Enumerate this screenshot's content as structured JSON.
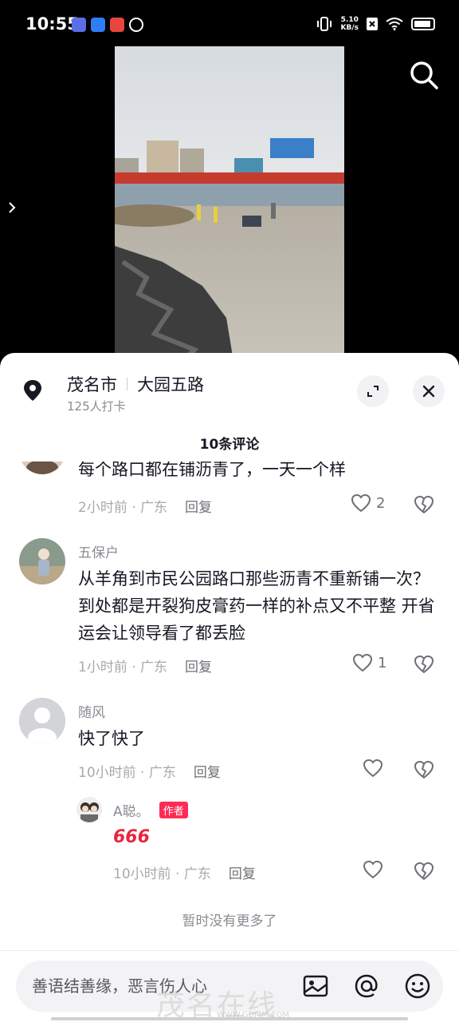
{
  "status_bar": {
    "time": "10:55",
    "net_speed_value": "5.10",
    "net_speed_unit": "KB/s",
    "icons": [
      "vibrate-icon",
      "close-box-icon",
      "wifi-icon",
      "battery-icon"
    ]
  },
  "video": {
    "icons": [
      "search-icon",
      "chevron-right-icon"
    ]
  },
  "location": {
    "city": "茂名市",
    "road": "大园五路",
    "checkins": "125人打卡",
    "icons": [
      "location-pin-icon",
      "expand-icon",
      "close-icon"
    ]
  },
  "comments_header": {
    "count_label": "10条评论"
  },
  "comments": [
    {
      "text": "每个路口都在铺沥青了，一天一个样",
      "time": "2小时前 · 广东",
      "reply_label": "回复",
      "likes": "2"
    },
    {
      "name": "五保户",
      "text": "从羊角到市民公园路口那些沥青不重新铺一次？到处都是开裂狗皮膏药一样的补点又不平整  开省运会让领导看了都丢脸",
      "time": "1小时前 · 广东",
      "reply_label": "回复",
      "likes": "1"
    },
    {
      "name": "随风",
      "text": "快了快了",
      "time": "10小时前 · 广东",
      "reply_label": "回复",
      "likes": ""
    }
  ],
  "reply": {
    "name": "A聪。",
    "tag": "作者",
    "text": "666",
    "time": "10小时前 · 广东",
    "reply_label": "回复"
  },
  "footer": {
    "no_more": "暂时没有更多了",
    "input_placeholder": "善语结善缘，恶言伤人心",
    "icons": [
      "image-icon",
      "at-icon",
      "emoji-icon"
    ]
  },
  "watermark": {
    "text": "茂名在线",
    "url": "WWW.GDMM.COM"
  },
  "colors": {
    "accent": "#fe2c55",
    "text_primary": "#161823",
    "text_secondary": "#8a8b91"
  }
}
